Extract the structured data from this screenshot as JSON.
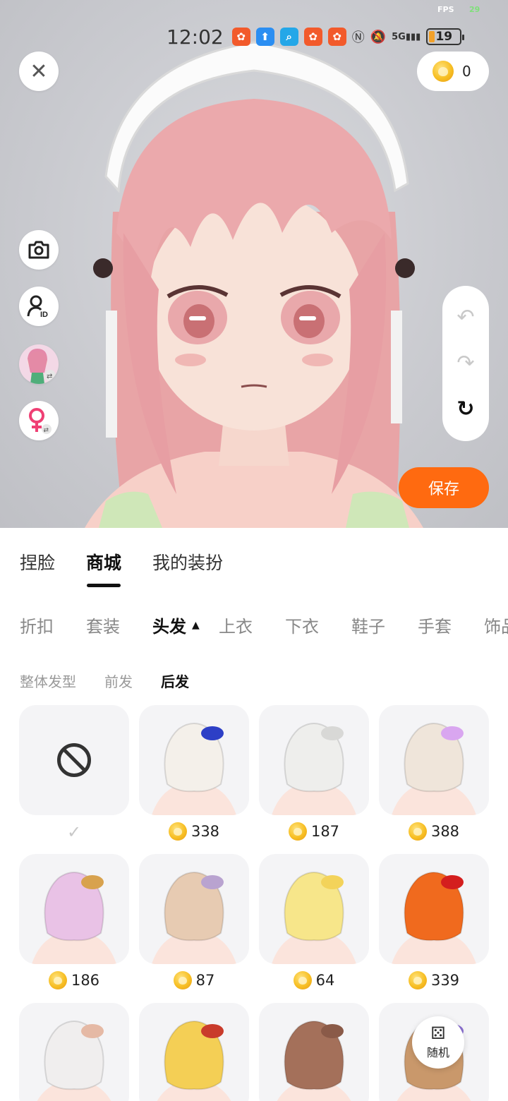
{
  "debug": {
    "fps_label": "FPS",
    "fps_value": "29"
  },
  "status_bar": {
    "time": "12:02",
    "battery": "19",
    "icons": [
      "app-icon",
      "upload-icon",
      "search-app-icon",
      "app-icon",
      "app-icon",
      "nfc-icon",
      "mute-icon",
      "signal-5g-icon"
    ],
    "signal_label": "5G"
  },
  "header": {
    "coin_balance": "0",
    "close_icon": "close-icon"
  },
  "side_actions": [
    "camera-icon",
    "user-id-icon",
    "avatar-switch",
    "gender-female-icon"
  ],
  "history": [
    "undo-icon",
    "redo-icon",
    "reset-icon"
  ],
  "save_label": "保存",
  "main_tabs": [
    {
      "label": "捏脸",
      "active": false
    },
    {
      "label": "商城",
      "active": true
    },
    {
      "label": "我的装扮",
      "active": false
    }
  ],
  "categories": [
    {
      "label": "折扣",
      "active": false
    },
    {
      "label": "套装",
      "active": false
    },
    {
      "label": "头发",
      "active": true
    },
    {
      "label": "上衣",
      "active": false
    },
    {
      "label": "下衣",
      "active": false
    },
    {
      "label": "鞋子",
      "active": false
    },
    {
      "label": "手套",
      "active": false
    },
    {
      "label": "饰品",
      "active": false
    }
  ],
  "sub_categories": [
    {
      "label": "整体发型",
      "active": false
    },
    {
      "label": "前发",
      "active": false
    },
    {
      "label": "后发",
      "active": true
    }
  ],
  "items": [
    {
      "type": "none",
      "selected": true
    },
    {
      "price": "338",
      "hair_color": "#f4f0ea",
      "accent": "#2d3fc6"
    },
    {
      "price": "187",
      "hair_color": "#eeeeec",
      "accent": "#d8d8d6"
    },
    {
      "price": "388",
      "hair_color": "#efe5da",
      "accent": "#d9a6f0"
    },
    {
      "price": "186",
      "hair_color": "#e9c2e6",
      "accent": "#d8a24e"
    },
    {
      "price": "87",
      "hair_color": "#e7cbb2",
      "accent": "#b9a3d0"
    },
    {
      "price": "64",
      "hair_color": "#f7e68a",
      "accent": "#f3d35a"
    },
    {
      "price": "339",
      "hair_color": "#f06a1e",
      "accent": "#d41e1e"
    },
    {
      "price": "",
      "hair_color": "#f0eeee",
      "accent": "#e5b9a5"
    },
    {
      "price": "",
      "hair_color": "#f4cf55",
      "accent": "#c93b2b"
    },
    {
      "price": "",
      "hair_color": "#a4705a",
      "accent": "#8a5a48"
    },
    {
      "price": "",
      "hair_color": "#c9986b",
      "accent": "#8a6fd0"
    }
  ],
  "random": {
    "label": "随机",
    "icon": "dice-icon"
  }
}
